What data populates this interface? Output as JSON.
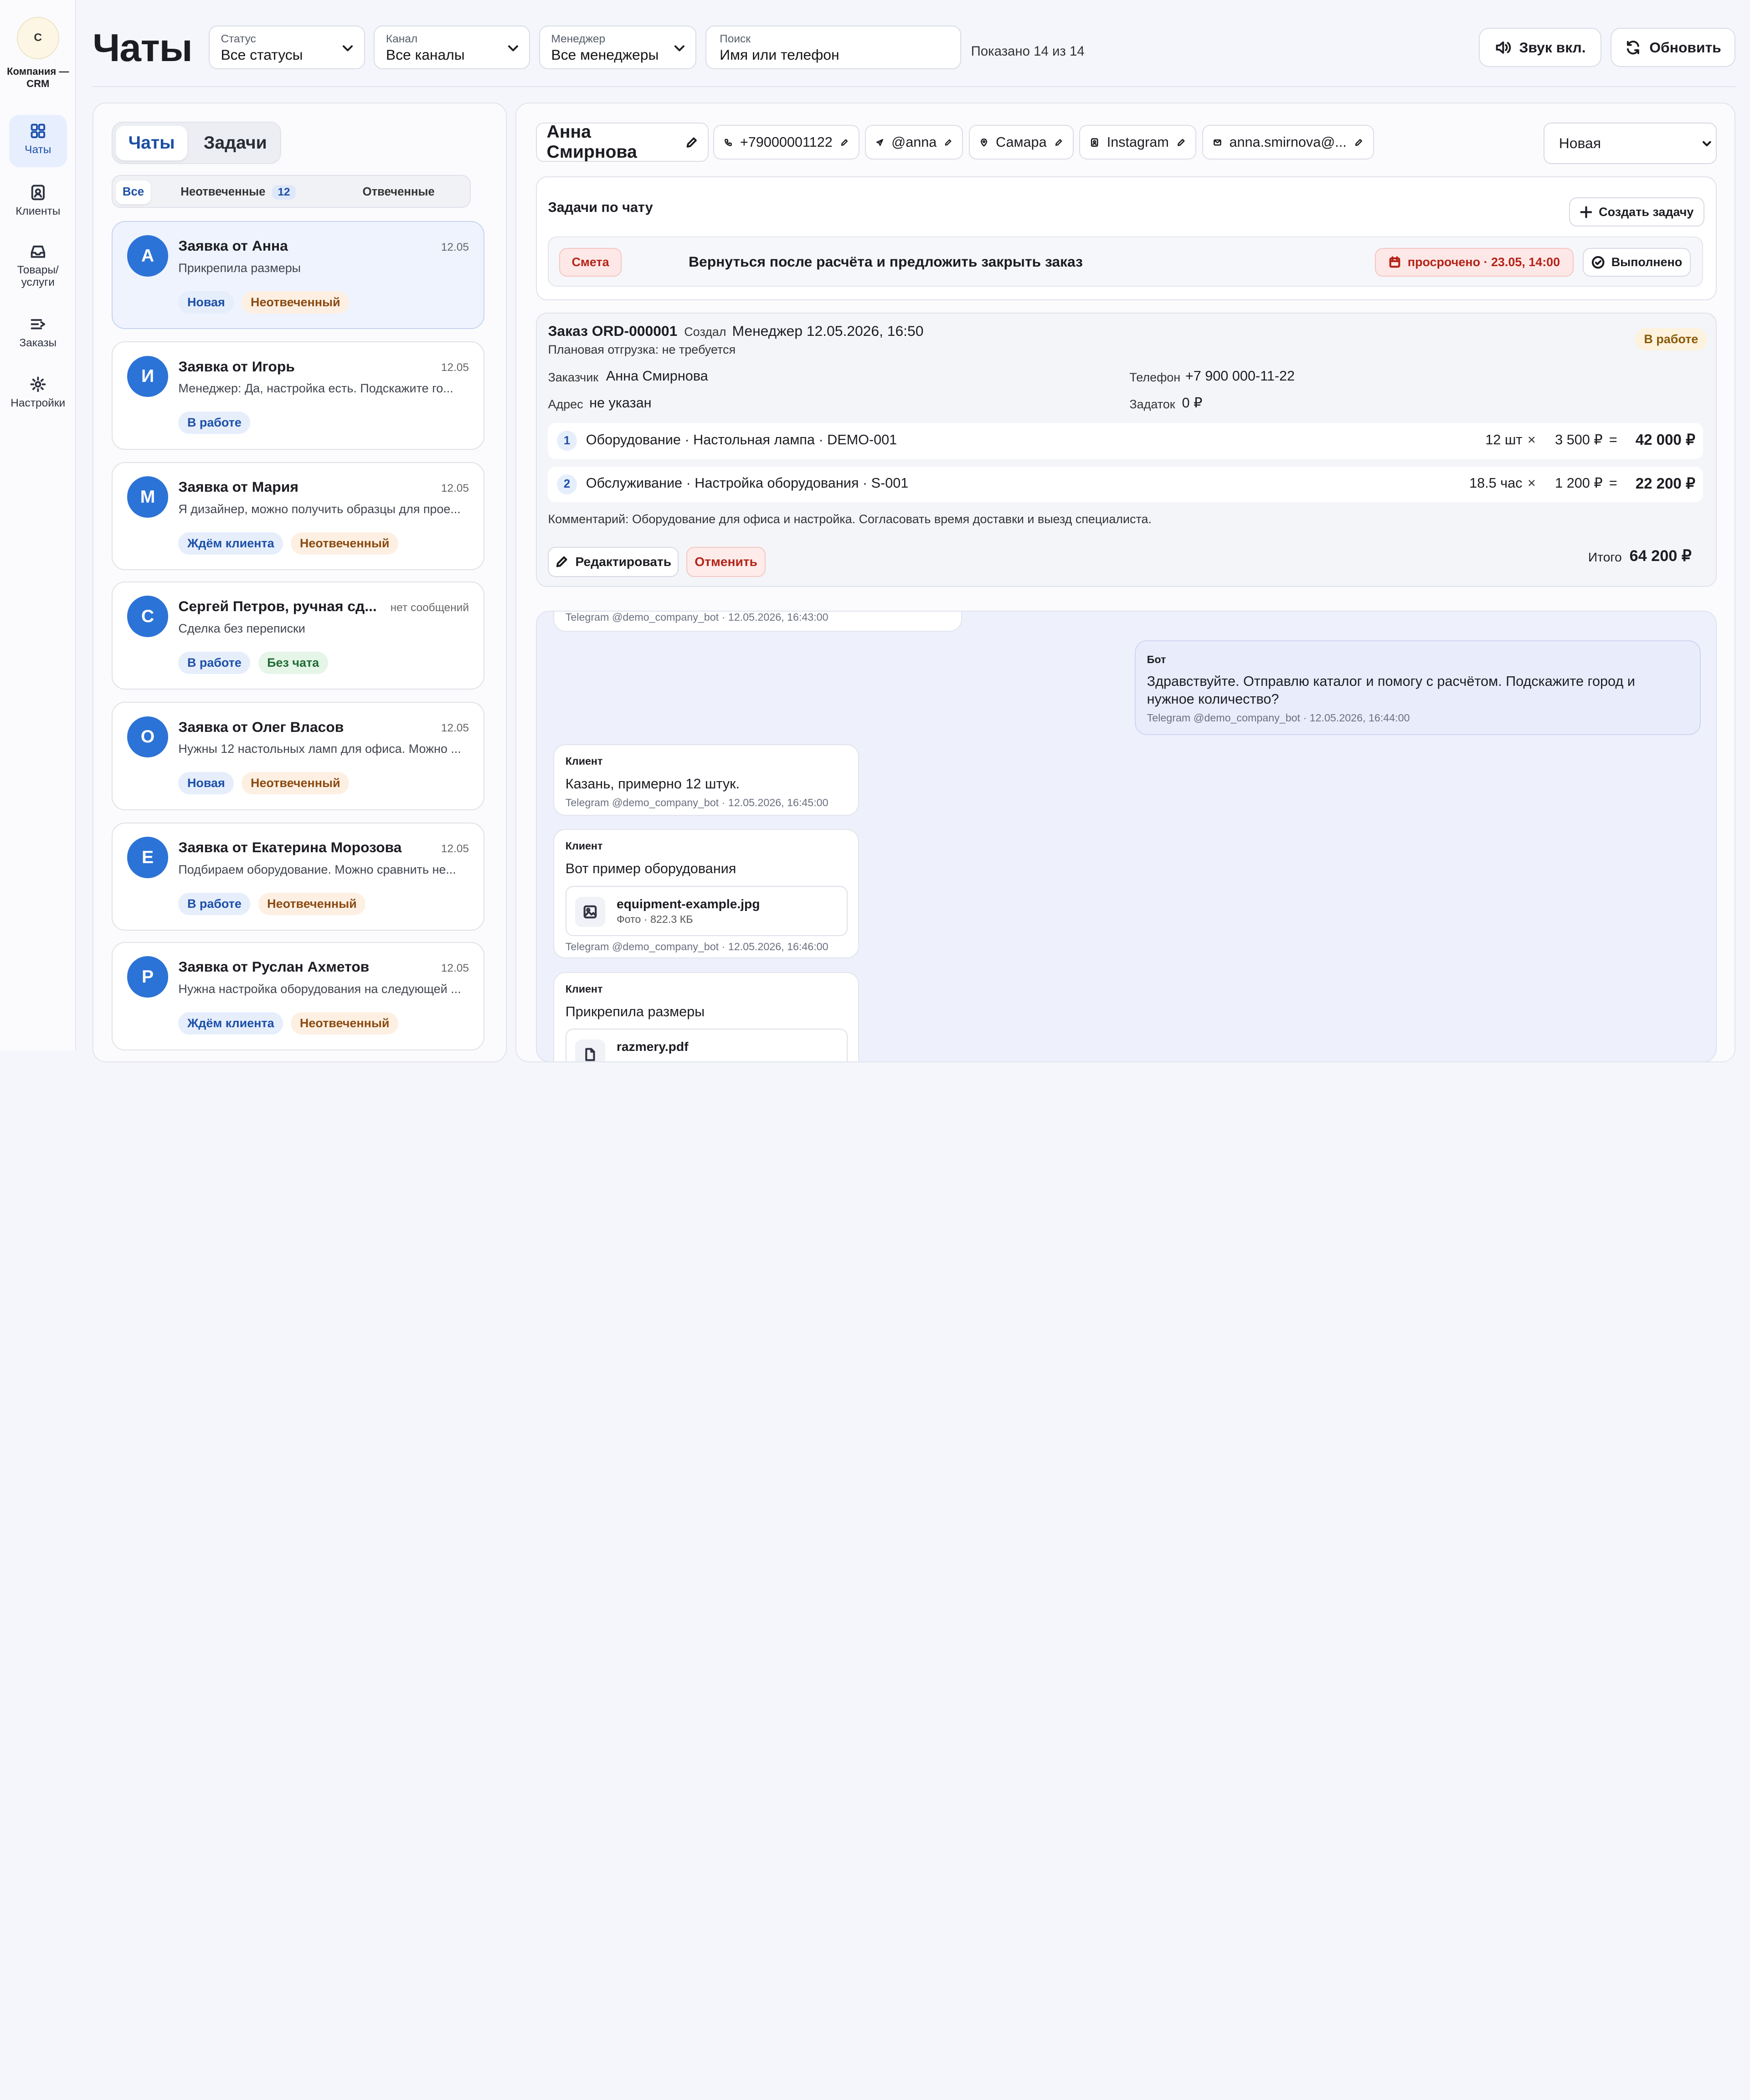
{
  "company": {
    "badge": "С",
    "name": "Компания — CRM"
  },
  "nav": [
    {
      "label": "Чаты",
      "icon": "grid-icon",
      "active": true
    },
    {
      "label": "Клиенты",
      "icon": "contact-icon"
    },
    {
      "label": "Товары/ услуги",
      "icon": "inbox-icon"
    },
    {
      "label": "Заказы",
      "icon": "list-icon"
    },
    {
      "label": "Настройки",
      "icon": "gear-icon"
    }
  ],
  "header": {
    "title": "Чаты",
    "filters": [
      {
        "label": "Статус",
        "value": "Все статусы"
      },
      {
        "label": "Канал",
        "value": "Все каналы"
      },
      {
        "label": "Менеджер",
        "value": "Все менеджеры"
      }
    ],
    "search": {
      "label": "Поиск",
      "placeholder": "Имя или телефон"
    },
    "shown": "Показано 14 из 14",
    "sound_button": "Звук вкл.",
    "refresh_button": "Обновить"
  },
  "list": {
    "tabs": [
      "Чаты",
      "Задачи"
    ],
    "filters": {
      "all": "Все",
      "unanswered": "Неотвеченные",
      "unanswered_count": "12",
      "answered": "Отвеченные"
    },
    "cards": [
      {
        "initial": "А",
        "name": "Заявка от Анна",
        "date": "12.05",
        "preview": "Прикрепила размеры",
        "tags": [
          {
            "text": "Новая",
            "kind": "blue"
          },
          {
            "text": "Неотвеченный",
            "kind": "orange"
          }
        ]
      },
      {
        "initial": "И",
        "name": "Заявка от Игорь",
        "date": "12.05",
        "preview": "Менеджер: Да, настройка есть. Подскажите го...",
        "tags": [
          {
            "text": "В работе",
            "kind": "blue"
          }
        ]
      },
      {
        "initial": "М",
        "name": "Заявка от Мария",
        "date": "12.05",
        "preview": "Я дизайнер, можно получить образцы для прое...",
        "tags": [
          {
            "text": "Ждём клиента",
            "kind": "blue"
          },
          {
            "text": "Неотвеченный",
            "kind": "orange"
          }
        ]
      },
      {
        "initial": "С",
        "name": "Сергей Петров, ручная сд...",
        "date": "нет сообщений",
        "preview": "Сделка без переписки",
        "tags": [
          {
            "text": "В работе",
            "kind": "blue"
          },
          {
            "text": "Без чата",
            "kind": "green"
          }
        ]
      },
      {
        "initial": "О",
        "name": "Заявка от Олег Власов",
        "date": "12.05",
        "preview": "Нужны 12 настольных ламп для офиса. Можно ...",
        "tags": [
          {
            "text": "Новая",
            "kind": "blue"
          },
          {
            "text": "Неотвеченный",
            "kind": "orange"
          }
        ]
      },
      {
        "initial": "Е",
        "name": "Заявка от Екатерина Морозова",
        "date": "12.05",
        "preview": "Подбираем оборудование. Можно сравнить не...",
        "tags": [
          {
            "text": "В работе",
            "kind": "blue"
          },
          {
            "text": "Неотвеченный",
            "kind": "orange"
          }
        ]
      },
      {
        "initial": "Р",
        "name": "Заявка от Руслан Ахметов",
        "date": "12.05",
        "preview": "Нужна настройка оборудования на следующей ...",
        "tags": [
          {
            "text": "Ждём клиента",
            "kind": "blue"
          },
          {
            "text": "Неотвеченный",
            "kind": "orange"
          }
        ]
      }
    ]
  },
  "contact": {
    "name": "Анна Смирнова",
    "phone": "+79000001122",
    "telegram": "@anna",
    "city": "Самара",
    "channel": "Instagram",
    "email": "anna.smirnova@...",
    "status": "Новая"
  },
  "tasks": {
    "title": "Задачи по чату",
    "create_button": "Создать задачу",
    "item": {
      "tag": "Смета",
      "text": "Вернуться после расчёта и предложить закрыть заказ",
      "due": "просрочено · 23.05, 14:00",
      "done_button": "Выполнено"
    }
  },
  "order": {
    "number": "Заказ ORD-000001",
    "created_label": "Создал",
    "created_value": "Менеджер 12.05.2026, 16:50",
    "shipment": "Плановая отгрузка: не требуется",
    "status": "В работе",
    "customer_label": "Заказчик",
    "customer": "Анна Смирнова",
    "phone_label": "Телефон",
    "phone": "+7 900 000-11-22",
    "address_label": "Адрес",
    "address": "не указан",
    "deposit_label": "Задаток",
    "deposit": "0 ₽",
    "items": [
      {
        "num": "1",
        "name": "Оборудование · Настольная лампа · DEMO-001",
        "qty": "12 шт",
        "price": "3 500 ₽",
        "total": "42 000 ₽"
      },
      {
        "num": "2",
        "name": "Обслуживание · Настройка оборудования · S-001",
        "qty": "18.5 час",
        "price": "1 200 ₽",
        "total": "22 200 ₽"
      }
    ],
    "comment": "Комментарий: Оборудование для офиса и настройка. Согласовать время доставки и выезд специалиста.",
    "edit_button": "Редактировать",
    "cancel_button": "Отменить",
    "total_label": "Итого",
    "total": "64 200 ₽"
  },
  "messages": [
    {
      "meta": "Telegram @demo_company_bot · 12.05.2026, 16:43:00"
    },
    {
      "who": "Бот",
      "text": "Здравствуйте. Отправлю каталог и помогу с расчётом. Подскажите город и нужное количество?",
      "meta": "Telegram @demo_company_bot · 12.05.2026, 16:44:00"
    },
    {
      "who": "Клиент",
      "text": "Казань, примерно 12 штук.",
      "meta": "Telegram @demo_company_bot · 12.05.2026, 16:45:00"
    },
    {
      "who": "Клиент",
      "text": "Вот пример оборудования",
      "attachment": {
        "name": "equipment-example.jpg",
        "size": "Фото · 822.3 КБ"
      },
      "meta": "Telegram @demo_company_bot · 12.05.2026, 16:46:00"
    },
    {
      "who": "Клиент",
      "text": "Прикрепила размеры",
      "attachment": {
        "name": "razmery.pdf"
      }
    }
  ]
}
